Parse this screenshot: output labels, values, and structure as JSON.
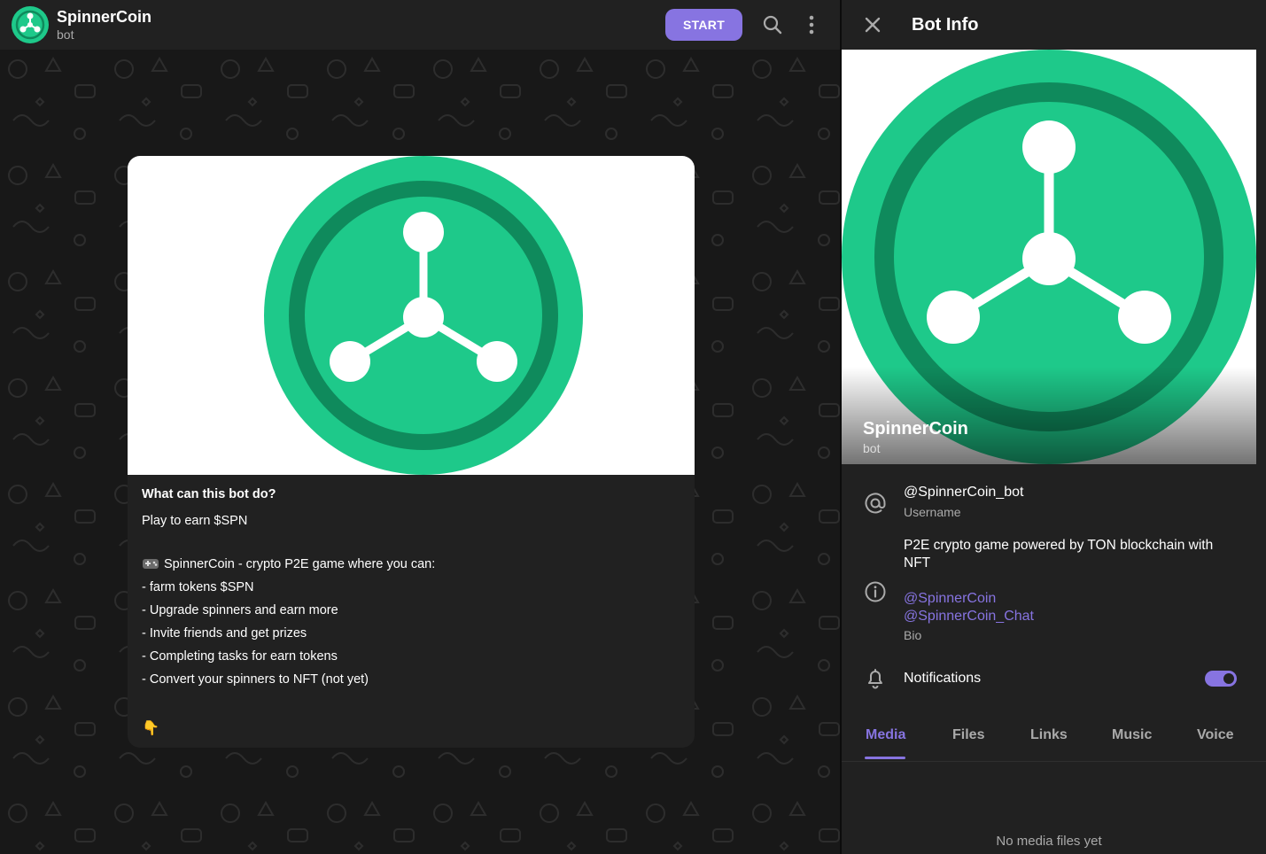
{
  "chat": {
    "header": {
      "name": "SpinnerCoin",
      "subtitle": "bot",
      "start_label": "START"
    },
    "message": {
      "question": "What can this bot do?",
      "tagline": "Play to earn $SPN",
      "intro": "SpinnerCoin - crypto P2E game where you can:",
      "features": [
        "- farm tokens $SPN",
        "- Upgrade spinners and earn more",
        "- Invite friends and get prizes",
        "- Completing tasks for earn tokens",
        "- Convert your spinners to NFT (not yet)"
      ],
      "pointer_emoji": "👇"
    }
  },
  "panel": {
    "title": "Bot Info",
    "profile": {
      "name": "SpinnerCoin",
      "subtitle": "bot"
    },
    "username": {
      "value": "@SpinnerCoin_bot",
      "label": "Username"
    },
    "bio": {
      "text": "P2E crypto game powered by TON blockchain with NFT",
      "links": [
        "@SpinnerCoin",
        "@SpinnerCoin_Chat"
      ],
      "label": "Bio"
    },
    "notifications": {
      "label": "Notifications",
      "enabled": true
    },
    "tabs": [
      "Media",
      "Files",
      "Links",
      "Music",
      "Voice"
    ],
    "active_tab": "Media",
    "empty_text": "No media files yet"
  },
  "colors": {
    "accent": "#8774e1",
    "logo_green": "#1ec98a",
    "logo_dark_ring": "#0f8a5c",
    "panel_bg": "#212121",
    "chat_bg": "#181818"
  },
  "icons": {
    "search": "search-icon",
    "menu": "more-vertical-icon",
    "close": "close-icon",
    "username": "at-sign-icon",
    "bio": "info-icon",
    "notifications": "bell-icon",
    "game": "gamepad-icon"
  }
}
